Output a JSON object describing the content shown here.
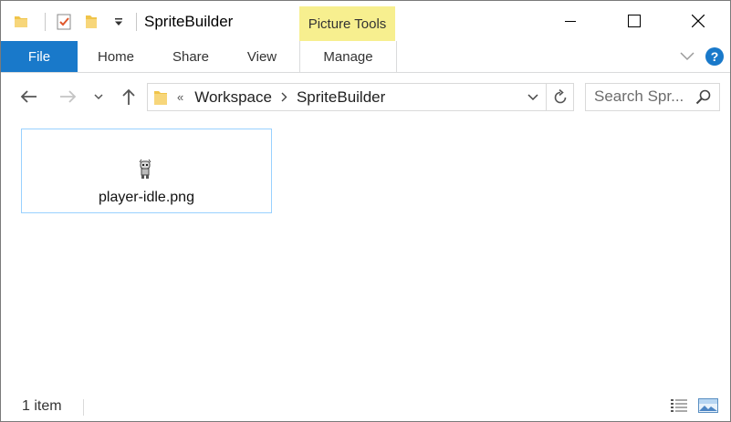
{
  "window": {
    "title": "SpriteBuilder"
  },
  "quick_access": [
    {
      "name": "folder-icon"
    },
    {
      "name": "properties-check-icon"
    },
    {
      "name": "new-folder-icon"
    },
    {
      "name": "customize-dropdown-icon"
    }
  ],
  "ribbon": {
    "context_group": "Picture Tools",
    "tabs": [
      {
        "label": "File",
        "active": true
      },
      {
        "label": "Home"
      },
      {
        "label": "Share"
      },
      {
        "label": "View"
      },
      {
        "label": "Manage"
      }
    ]
  },
  "address": {
    "overflow": "«",
    "breadcrumb": [
      "Workspace",
      "SpriteBuilder"
    ]
  },
  "search": {
    "placeholder": "Search Spr..."
  },
  "items": [
    {
      "name": "player-idle.png"
    }
  ],
  "status": {
    "item_count": "1 item"
  },
  "colors": {
    "accent": "#1979ca",
    "context_tab": "#f7ef8f",
    "selection_border": "#99d1ff"
  }
}
